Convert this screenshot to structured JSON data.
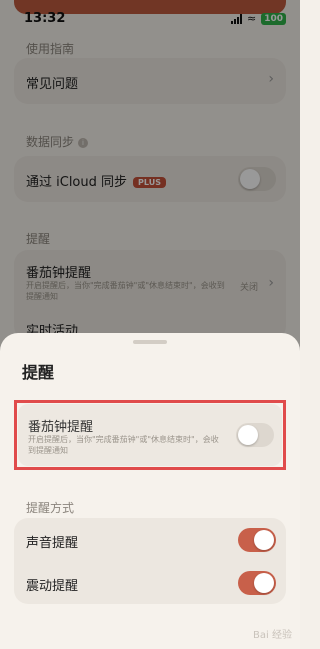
{
  "status": {
    "time": "13:32",
    "battery": "100"
  },
  "background": {
    "section_guide": "使用指南",
    "faq": "常见问题",
    "section_sync": "数据同步",
    "icloud_sync": "通过 iCloud 同步",
    "plus_badge": "PLUS",
    "section_reminder": "提醒",
    "pomodoro_title": "番茄钟提醒",
    "pomodoro_desc": "开启提醒后，当你\"完成番茄钟\"或\"休息结束时\"，会收到提醒通知",
    "pomodoro_value": "关闭",
    "live_activity": "实时活动"
  },
  "sheet": {
    "title": "提醒",
    "pomodoro_title": "番茄钟提醒",
    "pomodoro_desc": "开启提醒后，当你\"完成番茄钟\"或\"休息结束时\"，会收到提醒通知",
    "pomodoro_on": false,
    "section_method": "提醒方式",
    "sound": "声音提醒",
    "sound_on": true,
    "vibrate": "震动提醒",
    "vibrate_on": true
  },
  "watermark": "Bai 经验",
  "colors": {
    "accent": "#c8604a",
    "highlight": "#e04b4b",
    "plus": "#c3513a",
    "battery": "#2fb24a"
  }
}
